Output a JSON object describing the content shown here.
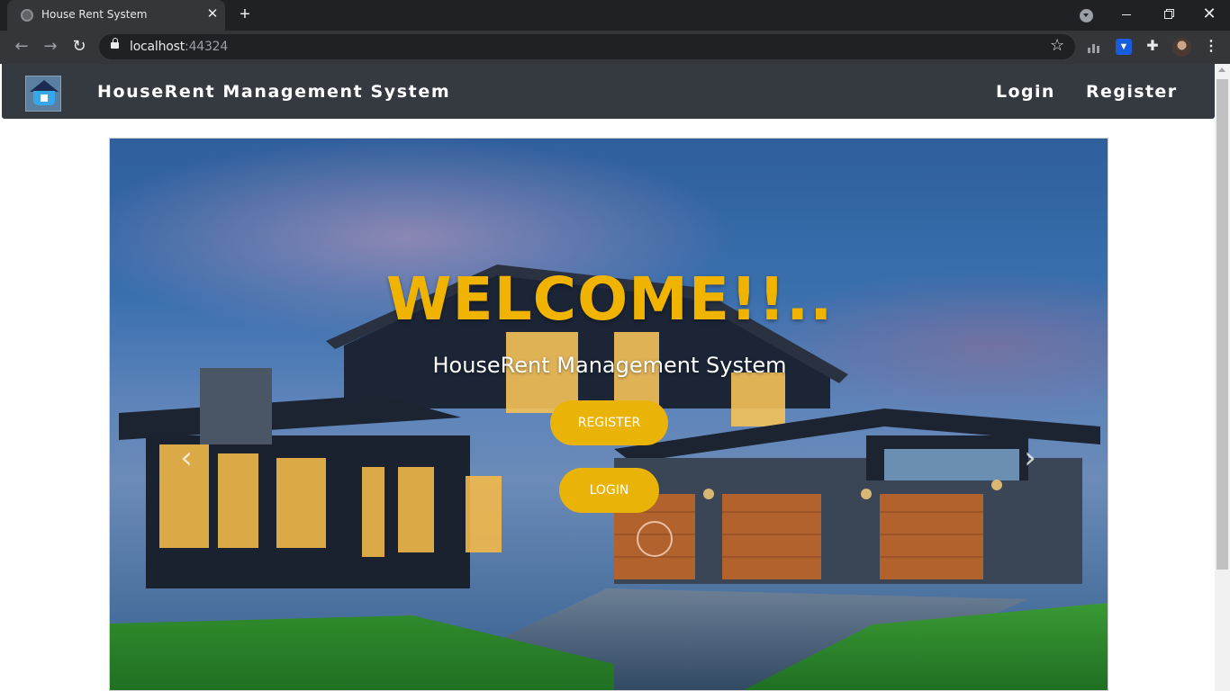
{
  "browser": {
    "tab_title": "House Rent System",
    "url_host": "localhost",
    "url_port": ":44324"
  },
  "navbar": {
    "brand_title": "HouseRent Management System",
    "login_label": "Login",
    "register_label": "Register"
  },
  "hero": {
    "title": "WELCOME!!..",
    "subtitle": "HouseRent Management System",
    "register_button": "REGISTER",
    "login_button": "LOGIN"
  }
}
